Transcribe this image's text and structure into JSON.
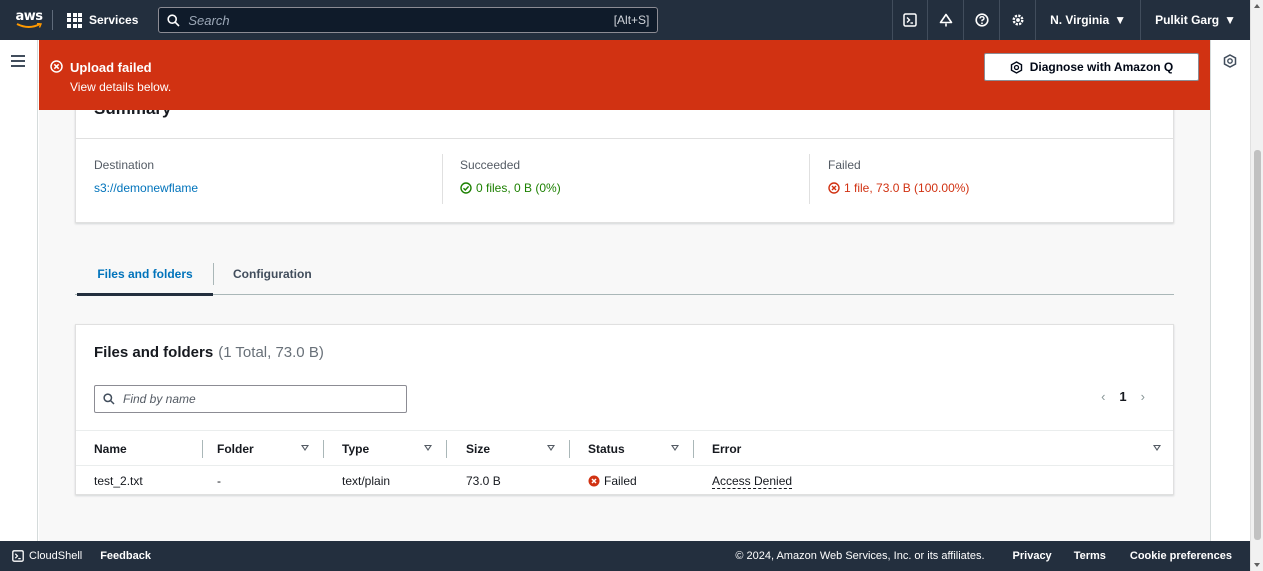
{
  "topnav": {
    "logo_text": "aws",
    "services_label": "Services",
    "search_placeholder": "Search",
    "search_shortcut": "[Alt+S]",
    "region": "N. Virginia",
    "user": "Pulkit Garg"
  },
  "flash": {
    "title": "Upload failed",
    "subtitle": "View details below.",
    "diagnose_label": "Diagnose with Amazon Q",
    "background_color": "#d13212"
  },
  "summary": {
    "title": "Summary",
    "destination_label": "Destination",
    "destination_value": "s3://demonewflame",
    "succeeded_label": "Succeeded",
    "succeeded_value": "0 files, 0 B (0%)",
    "failed_label": "Failed",
    "failed_value": "1 file, 73.0 B (100.00%)"
  },
  "tabs": [
    {
      "label": "Files and folders",
      "active": true
    },
    {
      "label": "Configuration",
      "active": false
    }
  ],
  "files_panel": {
    "title": "Files and folders",
    "count": "(1 Total, 73.0 B)",
    "find_placeholder": "Find by name",
    "page_current": "1",
    "columns": [
      "Name",
      "Folder",
      "Type",
      "Size",
      "Status",
      "Error"
    ],
    "rows": [
      {
        "name": "test_2.txt",
        "folder": "-",
        "type": "text/plain",
        "size": "73.0 B",
        "status": "Failed",
        "error": "Access Denied"
      }
    ]
  },
  "footer": {
    "cloudshell": "CloudShell",
    "feedback": "Feedback",
    "copyright": "© 2024, Amazon Web Services, Inc. or its affiliates.",
    "privacy": "Privacy",
    "terms": "Terms",
    "cookies": "Cookie preferences"
  },
  "colors": {
    "nav_bg": "#232f3e",
    "link": "#0073bb",
    "success": "#1d8102",
    "error": "#d13212"
  }
}
